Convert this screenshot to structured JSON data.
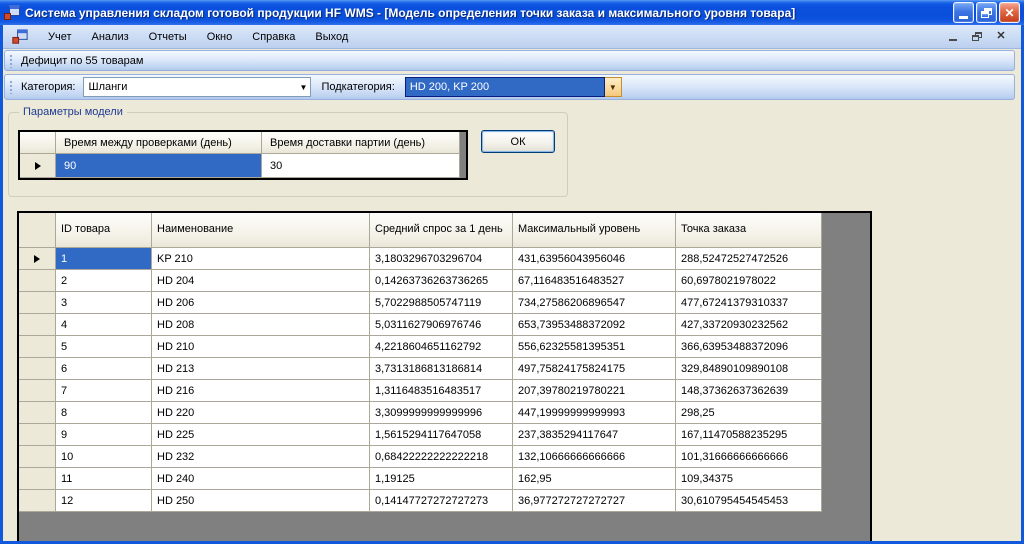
{
  "window": {
    "title": "Система управления складом готовой продукции HF WMS - [Модель определения точки заказа и максимального уровня товара]"
  },
  "menu": {
    "items": [
      "Учет",
      "Анализ",
      "Отчеты",
      "Окно",
      "Справка",
      "Выход"
    ]
  },
  "toolbar_status": {
    "label": "Дефицит по 55 товарам"
  },
  "filters": {
    "category_label": "Категория:",
    "category_value": "Шланги",
    "subcategory_label": "Подкатегория:",
    "subcategory_value": "HD 200, KP 200"
  },
  "model_params": {
    "group_title": "Параметры модели",
    "columns": [
      "Время между проверками (день)",
      "Время доставки партии (день)"
    ],
    "values": [
      "90",
      "30"
    ],
    "ok_label": "ОК"
  },
  "main_grid": {
    "columns": [
      "ID товара",
      "Наименование",
      "Средний спрос за 1 день",
      "Максимальный уровень",
      "Точка заказа"
    ],
    "rows": [
      {
        "selected": true,
        "cells": [
          "1",
          "KP 210",
          "3,1803296703296704",
          "431,63956043956046",
          "288,52472527472526"
        ]
      },
      {
        "selected": false,
        "cells": [
          "2",
          "HD 204",
          "0,14263736263736265",
          "67,116483516483527",
          "60,6978021978022"
        ]
      },
      {
        "selected": false,
        "cells": [
          "3",
          "HD 206",
          "5,7022988505747119",
          "734,27586206896547",
          "477,67241379310337"
        ]
      },
      {
        "selected": false,
        "cells": [
          "4",
          "HD 208",
          "5,0311627906976746",
          "653,73953488372092",
          "427,33720930232562"
        ]
      },
      {
        "selected": false,
        "cells": [
          "5",
          "HD 210",
          "4,2218604651162792",
          "556,62325581395351",
          "366,63953488372096"
        ]
      },
      {
        "selected": false,
        "cells": [
          "6",
          "HD 213",
          "3,7313186813186814",
          "497,75824175824175",
          "329,84890109890108"
        ]
      },
      {
        "selected": false,
        "cells": [
          "7",
          "HD 216",
          "1,3116483516483517",
          "207,39780219780221",
          "148,37362637362639"
        ]
      },
      {
        "selected": false,
        "cells": [
          "8",
          "HD 220",
          "3,3099999999999996",
          "447,19999999999993",
          "298,25"
        ]
      },
      {
        "selected": false,
        "cells": [
          "9",
          "HD 225",
          "1,5615294117647058",
          "237,3835294117647",
          "167,11470588235295"
        ]
      },
      {
        "selected": false,
        "cells": [
          "10",
          "HD 232",
          "0,68422222222222218",
          "132,10666666666666",
          "101,31666666666666"
        ]
      },
      {
        "selected": false,
        "cells": [
          "11",
          "HD 240",
          "1,19125",
          "162,95",
          "109,34375"
        ]
      },
      {
        "selected": false,
        "cells": [
          "12",
          "HD 250",
          "0,14147727272727273",
          "36,977272727272727",
          "30,610795454545453"
        ]
      }
    ]
  },
  "colors": {
    "selection": "#316AC5",
    "titlebar": "#0A50DD",
    "grid_filler": "#808080",
    "form_background": "#ECE9D8"
  }
}
